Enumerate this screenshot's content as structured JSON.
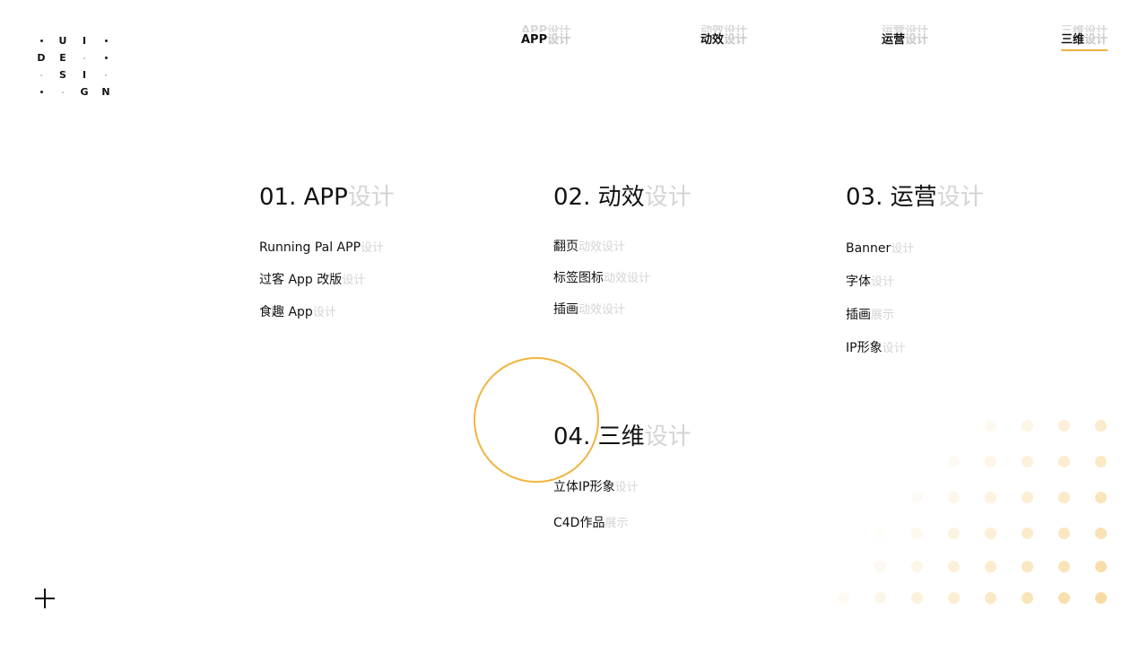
{
  "logo": {
    "grid": [
      [
        "•",
        "U",
        "I",
        "•"
      ],
      [
        "D",
        "E",
        "·",
        "•"
      ],
      [
        "·",
        "S",
        "I",
        "·"
      ],
      [
        "•",
        "·",
        "G",
        "N"
      ]
    ]
  },
  "nav": {
    "items": [
      {
        "ghost": "APP设计",
        "main": "APP",
        "dim": "设计",
        "active": false
      },
      {
        "ghost": "动效设计",
        "main": "动效",
        "dim": "设计",
        "active": false
      },
      {
        "ghost": "运营设计",
        "main": "运营",
        "dim": "设计",
        "active": false
      },
      {
        "ghost": "三维设计",
        "main": "三维",
        "dim": "设计",
        "active": true
      }
    ],
    "accent_color": "#f0b440"
  },
  "sections": [
    {
      "title": "01. APP",
      "title_dim": "设计",
      "items": [
        {
          "label": "Running Pal APP",
          "dim": "设计"
        },
        {
          "label": "过客 App 改版",
          "dim": "设计"
        },
        {
          "label": "食趣 App",
          "dim": "设计"
        }
      ]
    },
    {
      "title": "02. 动效",
      "title_dim": "设计",
      "items": [
        {
          "label": "翻页",
          "dim": "动效设计"
        },
        {
          "label": "标签图标",
          "dim": "动效设计"
        },
        {
          "label": "插画",
          "dim": "动效设计"
        }
      ]
    },
    {
      "title": "03. 运营",
      "title_dim": "设计",
      "items": [
        {
          "label": "Banner",
          "dim": "设计"
        },
        {
          "label": "字体",
          "dim": "设计"
        },
        {
          "label": "插画",
          "dim": "展示"
        },
        {
          "label": "IP形象",
          "dim": "设计"
        }
      ]
    },
    {
      "title": "04. 三维",
      "title_dim": "设计",
      "items": [
        {
          "label": "立体IP形象",
          "dim": "设计"
        },
        {
          "label": "C4D作品",
          "dim": "展示"
        }
      ]
    }
  ],
  "decor": {
    "circle_color": "#efb53f",
    "dot_color": "#f7d79a",
    "icons": [
      "plus-icon"
    ]
  }
}
